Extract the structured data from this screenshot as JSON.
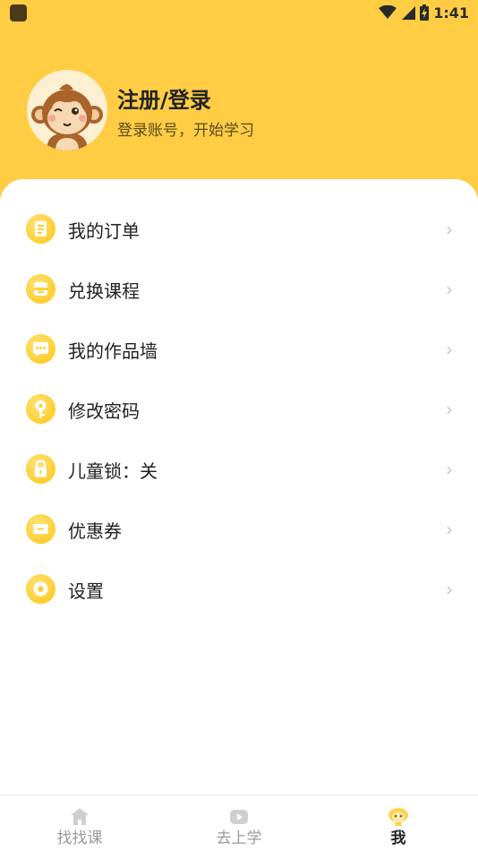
{
  "status_bar": {
    "time": "1:41"
  },
  "profile": {
    "title": "注册/登录",
    "subtitle": "登录账号，开始学习"
  },
  "menu": {
    "items": [
      {
        "label": "我的订单",
        "icon": "order-icon"
      },
      {
        "label": "兑换课程",
        "icon": "redeem-icon"
      },
      {
        "label": "我的作品墙",
        "icon": "works-icon"
      },
      {
        "label": "修改密码",
        "icon": "key-icon"
      },
      {
        "label": "儿童锁：关",
        "icon": "lock-icon"
      },
      {
        "label": "优惠券",
        "icon": "coupon-icon"
      },
      {
        "label": "设置",
        "icon": "settings-icon"
      }
    ],
    "chevron": "›"
  },
  "bottom_nav": {
    "tabs": [
      {
        "label": "找找课",
        "icon": "home-icon"
      },
      {
        "label": "去上学",
        "icon": "video-icon"
      },
      {
        "label": "我",
        "icon": "monkey-icon"
      }
    ],
    "active_tab": "我"
  },
  "colors": {
    "header_yellow": "#FFCD44",
    "icon_yellow": "#FFCE2E",
    "chevron_gray": "#C7C7C7",
    "inactive_tab": "#9A9A9A"
  }
}
